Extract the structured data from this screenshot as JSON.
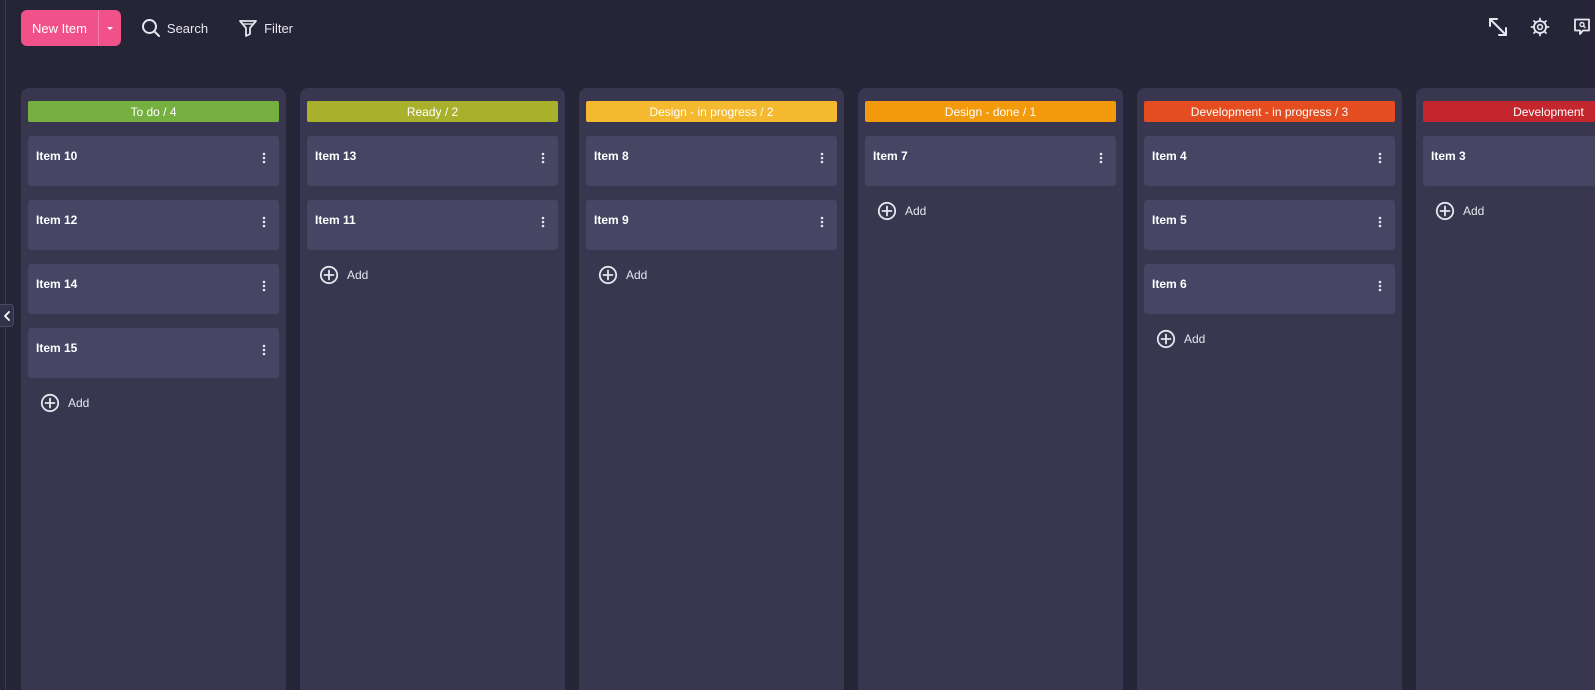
{
  "toolbar": {
    "new_item_label": "New Item",
    "search_label": "Search",
    "filter_label": "Filter"
  },
  "colors": {
    "accent": "#f05189",
    "background": "#262538",
    "column_bg": "#38374f",
    "card_bg": "#464564"
  },
  "top_right_icons": [
    "expand-icon",
    "settings-icon",
    "feedback-icon"
  ],
  "add_label": "Add",
  "columns": [
    {
      "header": "To do / 4",
      "color": "#76b041",
      "items": [
        "Item 10",
        "Item 12",
        "Item 14",
        "Item 15"
      ]
    },
    {
      "header": "Ready / 2",
      "color": "#a9b12c",
      "items": [
        "Item 13",
        "Item 11"
      ]
    },
    {
      "header": "Design - in progress / 2",
      "color": "#f4b92e",
      "items": [
        "Item 8",
        "Item 9"
      ]
    },
    {
      "header": "Design - done / 1",
      "color": "#f39a0c",
      "items": [
        "Item 7"
      ]
    },
    {
      "header": "Development - in progress / 3",
      "color": "#e44d1f",
      "items": [
        "Item 4",
        "Item 5",
        "Item 6"
      ]
    },
    {
      "header": "Development",
      "color": "#c4262e",
      "items": [
        "Item 3"
      ]
    }
  ]
}
